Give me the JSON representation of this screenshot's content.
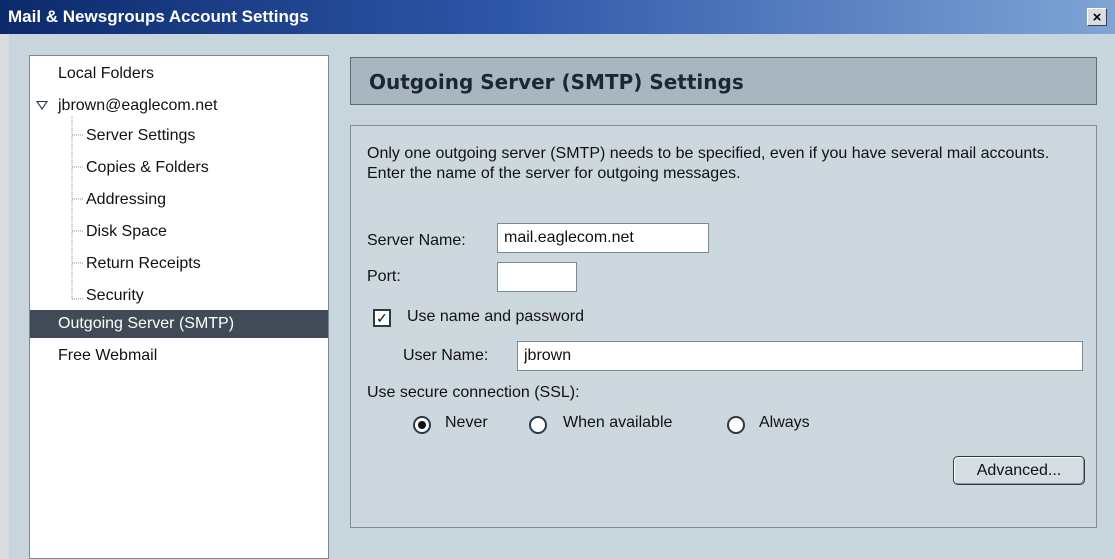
{
  "window": {
    "title": "Mail & Newsgroups Account Settings",
    "close_label": "×"
  },
  "sidebar": {
    "items": [
      {
        "label": "Local Folders",
        "level": "root"
      },
      {
        "label": "jbrown@eaglecom.net",
        "level": "root",
        "expanded": true
      },
      {
        "label": "Server Settings",
        "level": "child"
      },
      {
        "label": "Copies & Folders",
        "level": "child"
      },
      {
        "label": "Addressing",
        "level": "child"
      },
      {
        "label": "Disk Space",
        "level": "child"
      },
      {
        "label": "Return Receipts",
        "level": "child"
      },
      {
        "label": "Security",
        "level": "child"
      },
      {
        "label": "Outgoing Server (SMTP)",
        "level": "root",
        "selected": true
      },
      {
        "label": "Free Webmail",
        "level": "root"
      }
    ]
  },
  "main": {
    "header": "Outgoing Server (SMTP) Settings",
    "description": "Only one outgoing server (SMTP) needs to be specified, even if you have several mail accounts. Enter the name of the server for outgoing messages.",
    "server_name_label": "Server Name:",
    "server_name_value": "mail.eaglecom.net",
    "port_label": "Port:",
    "port_value": "",
    "use_auth_label": "Use name and password",
    "use_auth_checked": true,
    "user_name_label": "User Name:",
    "user_name_value": "jbrown",
    "ssl_label": "Use secure connection (SSL):",
    "ssl_options": [
      {
        "label": "Never",
        "selected": true
      },
      {
        "label": "When available",
        "selected": false
      },
      {
        "label": "Always",
        "selected": false
      }
    ],
    "advanced_button": "Advanced..."
  },
  "colors": {
    "selection_bg": "#414b58",
    "panel_bg": "#c9d5dc",
    "header_bg": "#aab6bf"
  }
}
